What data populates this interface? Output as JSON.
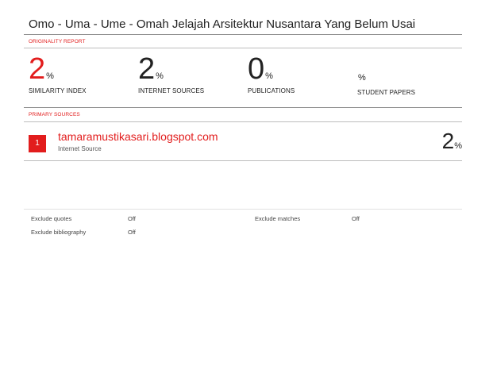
{
  "title": "Omo - Uma - Ume - Omah Jelajah Arsitektur Nusantara Yang Belum Usai",
  "originality_label": "ORIGINALITY REPORT",
  "stats": [
    {
      "value": "2",
      "suffix": "%",
      "label": "SIMILARITY INDEX"
    },
    {
      "value": "2",
      "suffix": "%",
      "label": "INTERNET SOURCES"
    },
    {
      "value": "0",
      "suffix": "%",
      "label": "PUBLICATIONS"
    },
    {
      "value": "",
      "suffix": "%",
      "label": "STUDENT PAPERS"
    }
  ],
  "primary_label": "PRIMARY SOURCES",
  "sources": [
    {
      "rank": "1",
      "name": "tamaramustikasari.blogspot.com",
      "type": "Internet Source",
      "value": "2",
      "suffix": "%"
    }
  ],
  "exclusions": {
    "quotes": {
      "label": "Exclude quotes",
      "value": "Off"
    },
    "bibliography": {
      "label": "Exclude bibliography",
      "value": "Off"
    },
    "matches": {
      "label": "Exclude matches",
      "value": "Off"
    }
  },
  "colors": {
    "accent": "#e21d1d",
    "rule": "#bdbdbd"
  }
}
